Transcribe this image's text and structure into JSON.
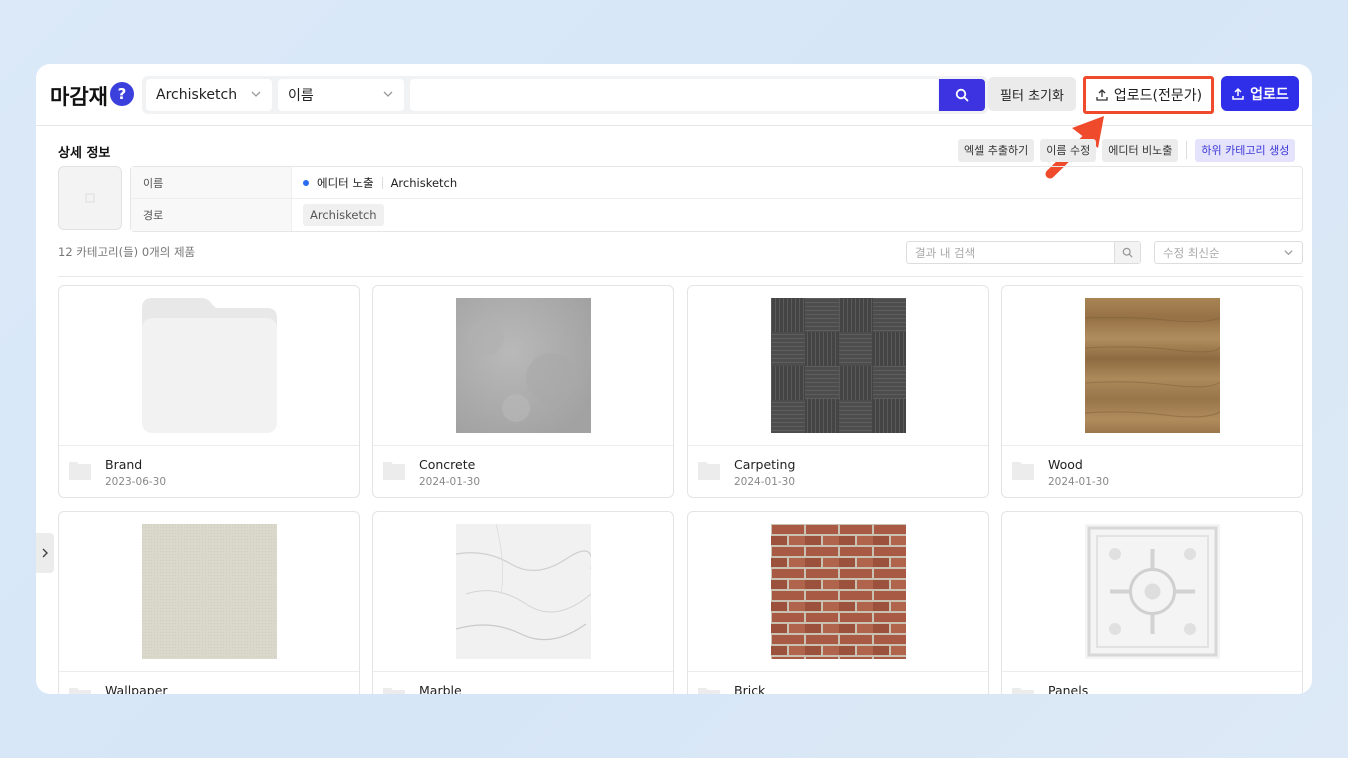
{
  "header": {
    "title": "마감재",
    "help_label": "?",
    "brand_select": "Archisketch",
    "field_select": "이름",
    "search_value": "",
    "reset_label": "필터 초기화",
    "upload_pro_label": "업로드(전문가)",
    "upload_label": "업로드",
    "highlight_color": "#ef4a2c",
    "accent_color": "#2f2ee8"
  },
  "detail": {
    "section_title": "상세 정보",
    "actions": [
      "엑셀 추출하기",
      "이름 수정",
      "에디터 비노출",
      "하위 카테고리 생성"
    ],
    "rows": {
      "name_label": "이름",
      "status": "에디터 노출",
      "name_value": "Archisketch",
      "path_label": "경로",
      "path_value": "Archisketch"
    }
  },
  "results": {
    "count_text": "12 카테고리(들) 0개의 제품",
    "search_placeholder": "결과 내 검색",
    "sort_placeholder": "수정 최신순"
  },
  "cards": [
    {
      "name": "Brand",
      "date": "2023-06-30",
      "thumb": "folder"
    },
    {
      "name": "Concrete",
      "date": "2024-01-30",
      "thumb": "concrete"
    },
    {
      "name": "Carpeting",
      "date": "2024-01-30",
      "thumb": "carpet"
    },
    {
      "name": "Wood",
      "date": "2024-01-30",
      "thumb": "wood"
    },
    {
      "name": "Wallpaper",
      "date": "",
      "thumb": "wallpaper"
    },
    {
      "name": "Marble",
      "date": "",
      "thumb": "marble"
    },
    {
      "name": "Brick",
      "date": "",
      "thumb": "brick"
    },
    {
      "name": "Panels",
      "date": "",
      "thumb": "panels"
    }
  ]
}
